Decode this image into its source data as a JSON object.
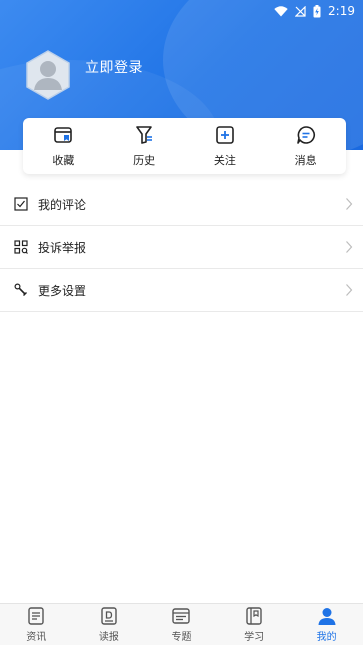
{
  "status_bar": {
    "time": "2:19"
  },
  "profile": {
    "login_label": "立即登录"
  },
  "quick_actions": [
    {
      "label": "收藏",
      "icon": "favorite-icon"
    },
    {
      "label": "历史",
      "icon": "history-icon"
    },
    {
      "label": "关注",
      "icon": "follow-icon"
    },
    {
      "label": "消息",
      "icon": "message-icon"
    }
  ],
  "menu": [
    {
      "label": "我的评论",
      "icon": "comment-icon"
    },
    {
      "label": "投诉举报",
      "icon": "report-icon"
    },
    {
      "label": "更多设置",
      "icon": "settings-icon"
    }
  ],
  "tabs": [
    {
      "label": "资讯",
      "icon": "news-icon"
    },
    {
      "label": "读报",
      "icon": "newspaper-icon"
    },
    {
      "label": "专题",
      "icon": "topic-icon"
    },
    {
      "label": "学习",
      "icon": "study-icon"
    },
    {
      "label": "我的",
      "icon": "profile-icon",
      "active": true
    }
  ],
  "colors": {
    "accent": "#1f73e6",
    "header": "#2a7deb"
  }
}
